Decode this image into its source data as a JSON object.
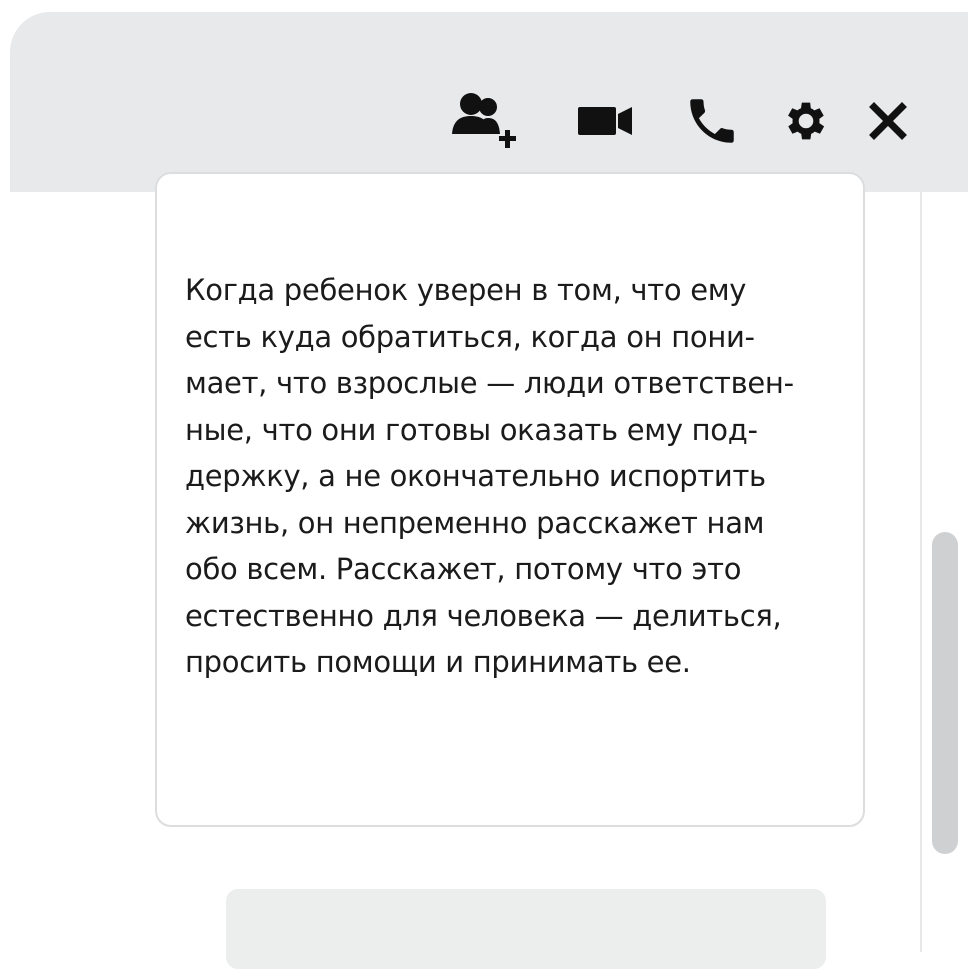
{
  "header": {
    "icons": [
      {
        "name": "add-participant-icon"
      },
      {
        "name": "video-call-icon"
      },
      {
        "name": "phone-call-icon"
      },
      {
        "name": "settings-icon"
      },
      {
        "name": "close-icon"
      }
    ]
  },
  "messages": [
    {
      "text": "Когда ребенок уверен в том, что ему\nесть куда обратиться, когда он пони-\nмает, что взрослые — люди ответствен-\nные, что они готовы оказать ему под-\nдержку, а не окончательно испортить\nжизнь, он непременно расскажет нам\nобо всем. Расскажет, потому что это\nестественно для человека — делиться,\nпросить помощи и принимать ее."
    }
  ],
  "colors": {
    "header_bg": "#e8e9ea",
    "icon": "#111111",
    "bubble_border": "#dcdddf",
    "scroll_thumb": "#cfd0d1"
  }
}
